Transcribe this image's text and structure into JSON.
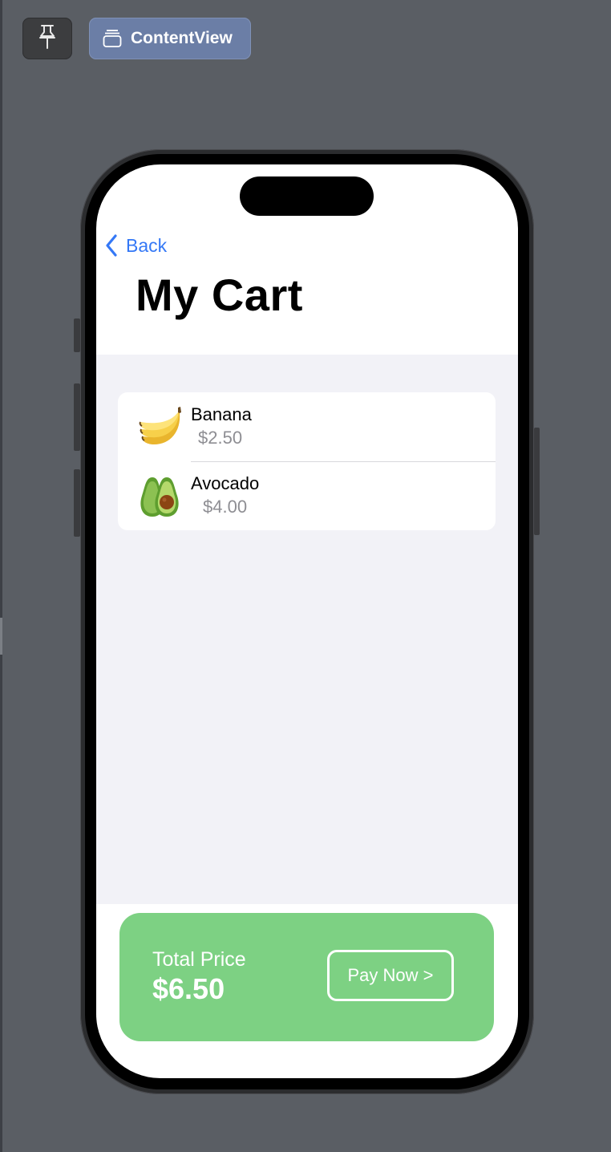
{
  "toolbar": {
    "pin_icon": "pin-icon",
    "view_icon": "stack-layers-icon",
    "view_label": "ContentView"
  },
  "nav": {
    "back_icon": "chevron-left-icon",
    "back_label": "Back",
    "title": "My Cart"
  },
  "cart": {
    "items": [
      {
        "name": "Banana",
        "price": "$2.50",
        "icon": "banana-icon"
      },
      {
        "name": "Avocado",
        "price": "$4.00",
        "icon": "avocado-icon"
      }
    ]
  },
  "footer": {
    "total_label": "Total Price",
    "total_value": "$6.50",
    "pay_label": "Pay Now >"
  },
  "colors": {
    "accent_blue": "#3478f6",
    "pay_green": "#7dd183",
    "list_background": "#f2f2f7",
    "secondary_text": "#8e8e93"
  }
}
